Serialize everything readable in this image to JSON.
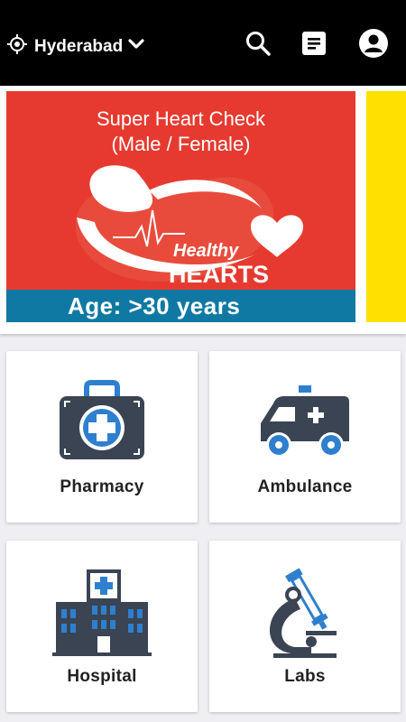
{
  "header": {
    "location": "Hyderabad",
    "icons": [
      "location-target-icon",
      "chevron-down-icon",
      "search-icon",
      "orders-list-icon",
      "account-avatar-icon"
    ]
  },
  "banner": {
    "title_line1": "Super Heart Check",
    "title_line2": "(Male / Female)",
    "logo_word1": "Healthy",
    "logo_word2": "HEARTS",
    "footer": "Age: >30 years",
    "colors": {
      "slide_bg": "#e63a30",
      "footer_bg": "#0f79a3",
      "next_slide": "#ffe000"
    }
  },
  "services": [
    {
      "label": "Pharmacy",
      "icon": "medical-kit-icon"
    },
    {
      "label": "Ambulance",
      "icon": "ambulance-icon"
    },
    {
      "label": "Hospital",
      "icon": "hospital-building-icon"
    },
    {
      "label": "Labs",
      "icon": "microscope-icon"
    }
  ],
  "colors": {
    "icon_dark": "#3a4453",
    "icon_blue": "#2f7fcf",
    "topbar": "#000000"
  }
}
